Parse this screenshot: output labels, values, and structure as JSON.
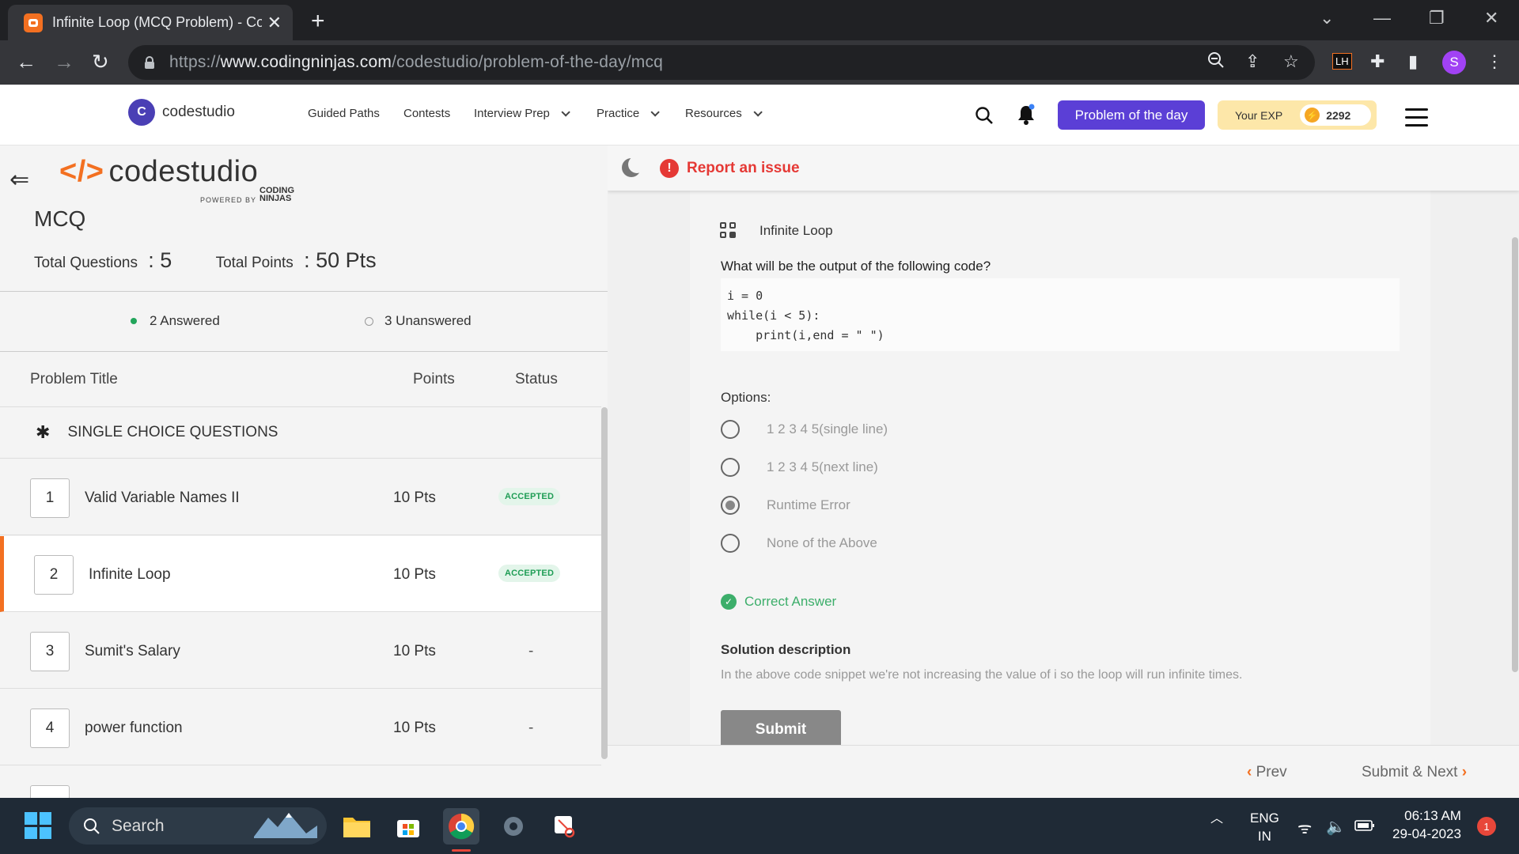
{
  "browser": {
    "tab_title": "Infinite Loop (MCQ Problem) - Co",
    "url_prefix": "https://",
    "url_domain": "www.codingninjas.com",
    "url_path": "/codestudio/problem-of-the-day/mcq",
    "extension_label": "LH",
    "profile_initial": "S"
  },
  "header": {
    "brand": "codestudio",
    "nav": [
      "Guided Paths",
      "Contests",
      "Interview Prep",
      "Practice",
      "Resources"
    ],
    "potd_button": "Problem of the day",
    "exp_label": "Your EXP",
    "exp_value": "2292"
  },
  "left": {
    "brand": "codestudio",
    "powered_by": "POWERED BY",
    "coding_ninjas": "CODING NINJAS",
    "title": "MCQ",
    "total_questions_label": "Total Questions",
    "total_questions_value": "5",
    "total_points_label": "Total Points",
    "total_points_value": "50 Pts",
    "answered": "2 Answered",
    "unanswered": "3 Unanswered",
    "columns": [
      "Problem Title",
      "Points",
      "Status"
    ],
    "section": "SINGLE CHOICE QUESTIONS",
    "rows": [
      {
        "num": "1",
        "title": "Valid Variable Names II",
        "points": "10 Pts",
        "status": "ACCEPTED"
      },
      {
        "num": "2",
        "title": "Infinite Loop",
        "points": "10 Pts",
        "status": "ACCEPTED"
      },
      {
        "num": "3",
        "title": "Sumit's Salary",
        "points": "10 Pts",
        "status": "-"
      },
      {
        "num": "4",
        "title": "power function",
        "points": "10 Pts",
        "status": "-"
      }
    ]
  },
  "right": {
    "report": "Report an issue",
    "question_name": "Infinite Loop",
    "question_text": "What will be the output of the following code?",
    "code_line1": "i = 0",
    "code_line2": "while(i < 5):",
    "code_line3": "    print(i,end = \" \")",
    "options_label": "Options:",
    "options": [
      "1 2 3 4 5(single line)",
      "1 2 3 4 5(next line)",
      "Runtime Error",
      "None of the Above"
    ],
    "selected_option": "Runtime Error",
    "correct_answer": "Correct Answer",
    "solution_title": "Solution description",
    "solution_text": "In the above code snippet we're not increasing the value of i so the loop will run infinite times.",
    "submit": "Submit",
    "prev": "Prev",
    "next": "Submit & Next"
  },
  "taskbar": {
    "search": "Search",
    "lang_line1": "ENG",
    "lang_line2": "IN",
    "time": "06:13 AM",
    "date": "29-04-2023",
    "notifications": "1"
  },
  "colors": {
    "accent": "#f37021",
    "primary": "#5b3fd6",
    "success": "#3cae6a",
    "danger": "#e53935"
  }
}
